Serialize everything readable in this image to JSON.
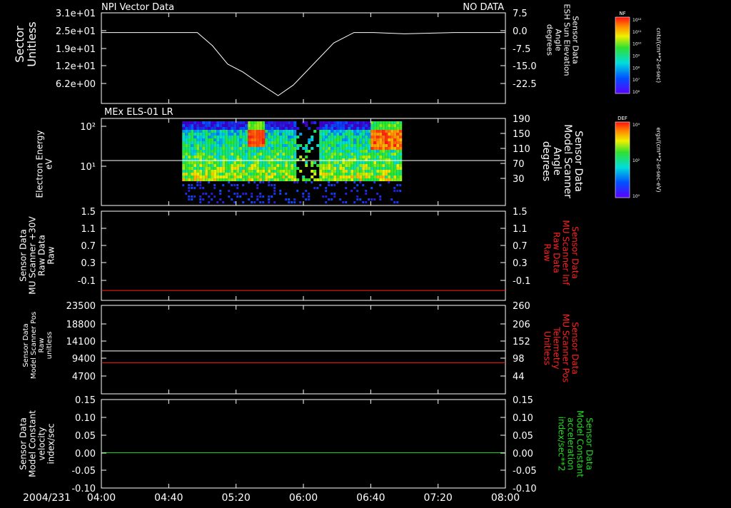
{
  "title_left": "NPI Vector Data",
  "title_right": "NO DATA",
  "date_label": "2004/231",
  "time_ticks": [
    "04:00",
    "04:40",
    "05:20",
    "06:00",
    "06:40",
    "07:20",
    "08:00"
  ],
  "colors": {
    "background": "#000000",
    "foreground": "#ffffff",
    "red_trace": "#ff2020",
    "green_trace": "#22dd22"
  },
  "panels": [
    {
      "left_label": [
        "Sector",
        "Unitless"
      ],
      "left_ticks": [
        "3.1e+01",
        "2.5e+01",
        "1.9e+01",
        "1.2e+01",
        "6.2e+00"
      ],
      "right_label": [
        "Sensor Data",
        "ESH Sun Elevation",
        "Angle",
        "degrees"
      ],
      "right_ticks": [
        "7.5",
        "0.0",
        "-7.5",
        "-15.0",
        "-22.5"
      ],
      "subtitle": ""
    },
    {
      "subtitle": "MEx ELS-01 LR",
      "left_label": [
        "Electron Energy",
        "eV"
      ],
      "left_ticks": [
        "10²",
        "10¹"
      ],
      "right_label": [
        "Sensor Data",
        "Model Scanner",
        "Angle",
        "degrees"
      ],
      "right_ticks": [
        "190",
        "150",
        "110",
        "70",
        "30"
      ]
    },
    {
      "left_label": [
        "Sensor Data",
        "MU Scanner +30V",
        "Raw Data",
        "Raw"
      ],
      "left_ticks": [
        "1.5",
        "1.1",
        "0.7",
        "0.3",
        "-0.1"
      ],
      "right_label": [
        "Sensor Data",
        "MU Scanner Inf",
        "Raw Data",
        "Raw"
      ],
      "right_ticks": [
        "1.5",
        "1.1",
        "0.7",
        "0.3",
        "-0.1"
      ]
    },
    {
      "left_label": [
        "Sensor Data",
        "Model Scanner Pos",
        "Raw",
        "unitless"
      ],
      "left_ticks": [
        "23500",
        "18800",
        "14100",
        "9400",
        "4700"
      ],
      "right_label": [
        "Sensor Data",
        "MU Scanner Pos",
        "Telemetry",
        "Unitless"
      ],
      "right_ticks": [
        "260",
        "206",
        "152",
        "98",
        "44"
      ]
    },
    {
      "left_label": [
        "Sensor Data",
        "Model Constant",
        "velocity",
        "index/sec"
      ],
      "left_ticks": [
        "0.15",
        "0.10",
        "0.05",
        "0.00",
        "-0.05",
        "-0.10"
      ],
      "right_label": [
        "Sensor Data",
        "Model Constant",
        "acceleration",
        "index/sec**2"
      ],
      "right_ticks": [
        "0.15",
        "0.10",
        "0.05",
        "0.00",
        "-0.05",
        "-0.10"
      ]
    }
  ],
  "colorbars": [
    {
      "name": "NF",
      "units": "cnts/(cm**2-sr-sec)",
      "ticks": [
        "10¹²",
        "10¹¹",
        "10¹⁰",
        "10⁹",
        "10⁸",
        "10⁷",
        "10⁶"
      ]
    },
    {
      "name": "DEF",
      "units": "ergs/(cm**2-sr-sec-eV)",
      "ticks": [
        "10⁴",
        "10²",
        "10⁰"
      ]
    }
  ],
  "chart_data": [
    {
      "type": "line",
      "x_unit": "UT hour",
      "xlim": [
        4.0,
        8.0
      ],
      "ylabel": "Sensor Data ESH Sun Elevation Angle degrees",
      "ylim": [
        -27,
        7.5
      ],
      "series": [
        {
          "x": [
            4.0,
            4.5,
            4.95,
            5.1,
            5.25,
            5.4,
            5.55,
            5.75,
            5.9,
            6.0,
            6.15,
            6.3,
            6.5,
            6.7,
            7.0,
            7.5,
            8.0
          ],
          "y": [
            0.0,
            0.0,
            0.0,
            -5.0,
            -12.0,
            -15.0,
            -19.0,
            -24.0,
            -20.0,
            -16.0,
            -10.0,
            -4.0,
            0.0,
            0.0,
            -0.5,
            0.0,
            0.0
          ]
        }
      ]
    },
    {
      "type": "heatmap",
      "x_unit": "UT hour",
      "xlim": [
        4.0,
        8.0
      ],
      "ylabel": "Electron Energy eV",
      "y_scale": "log",
      "data_span_x": [
        4.8,
        6.95
      ],
      "overlay_line_y": 14
    },
    {
      "type": "line",
      "xlim": [
        4.0,
        8.0
      ],
      "ylim": [
        -0.3,
        1.5
      ],
      "series": [
        {
          "x": [
            4.0,
            8.0
          ],
          "y": [
            -0.1,
            -0.1
          ]
        }
      ]
    },
    {
      "type": "line",
      "xlim": [
        4.0,
        8.0
      ],
      "ylim": [
        0,
        23500
      ],
      "series": [
        {
          "x": [
            4.0,
            8.0
          ],
          "y": [
            11400,
            11400
          ]
        },
        {
          "x": [
            4.0,
            8.0
          ],
          "y": [
            8300,
            8300
          ]
        }
      ]
    },
    {
      "type": "line",
      "xlim": [
        4.0,
        8.0
      ],
      "ylim": [
        -0.1,
        0.15
      ],
      "series": [
        {
          "x": [
            4.0,
            8.0
          ],
          "y": [
            0.0,
            0.0
          ]
        }
      ]
    }
  ]
}
